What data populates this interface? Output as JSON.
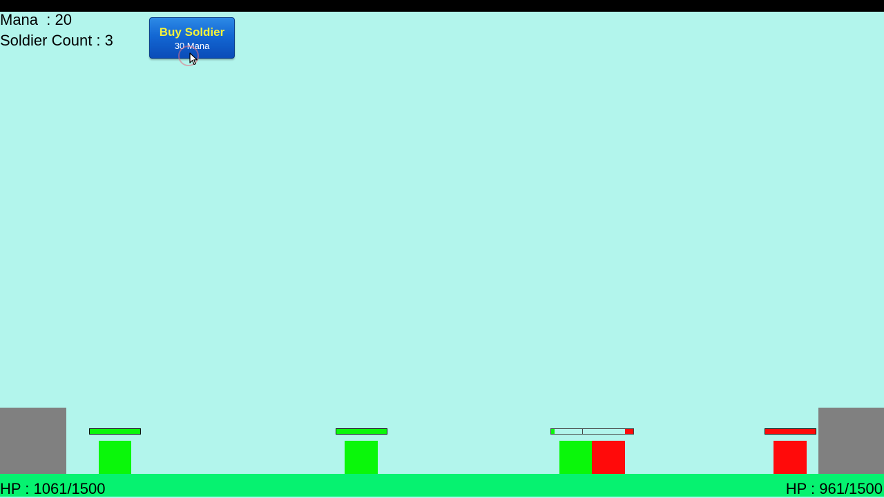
{
  "hud": {
    "mana_text": "Mana  : 20",
    "soldier_count_text": "Soldier Count : 3"
  },
  "buy_button": {
    "title": "Buy Soldier",
    "cost": "30 Mana"
  },
  "player_base": {
    "hp_text": "HP : 1061/1500",
    "hp": 1061,
    "hp_max": 1500
  },
  "enemy_base": {
    "hp_text": "HP : 961/1500",
    "hp": 961,
    "hp_max": 1500
  },
  "colors": {
    "sky": "#b2f5ec",
    "ground": "#06f270",
    "player_unit": "#0af70a",
    "enemy_unit": "#ff0a0a",
    "base": "#808080",
    "button": "#1367d3",
    "button_title": "#f7f33a"
  },
  "units": [
    {
      "side": "player",
      "health_fraction": 1.0
    },
    {
      "side": "player",
      "health_fraction": 1.0
    },
    {
      "side": "player",
      "health_fraction": 0.08
    },
    {
      "side": "enemy",
      "health_fraction": 0.17
    },
    {
      "side": "enemy",
      "health_fraction": 1.0
    }
  ]
}
